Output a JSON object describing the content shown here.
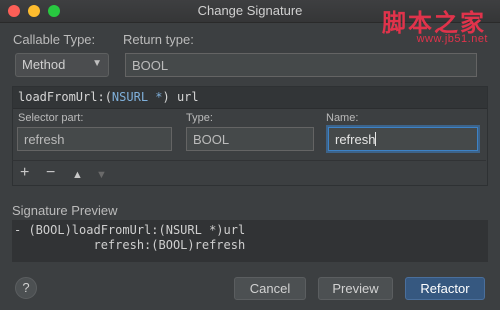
{
  "window": {
    "title": "Change Signature"
  },
  "watermark": {
    "text": "脚本之家",
    "url": "www.jb51.net"
  },
  "form": {
    "callable_type_label": "Callable Type:",
    "callable_type_value": "Method",
    "return_type_label": "Return type:",
    "return_type_value": "BOOL"
  },
  "signature": {
    "method_prefix": "loadFromUrl:(",
    "method_type": "NSURL *",
    "method_suffix": ") url",
    "selector_part_label": "Selector part:",
    "type_label": "Type:",
    "name_label": "Name:",
    "selector_part_value": "refresh",
    "type_value": "BOOL",
    "name_value": "refresh"
  },
  "toolbar": {
    "add_icon": "+",
    "remove_icon": "−",
    "up_icon": "▲",
    "down_icon": "▼"
  },
  "preview": {
    "label": "Signature Preview",
    "line1": "- (BOOL)loadFromUrl:(NSURL *)url",
    "line2": "           refresh:(BOOL)refresh"
  },
  "buttons": {
    "help": "?",
    "cancel": "Cancel",
    "preview": "Preview",
    "refactor": "Refactor"
  }
}
